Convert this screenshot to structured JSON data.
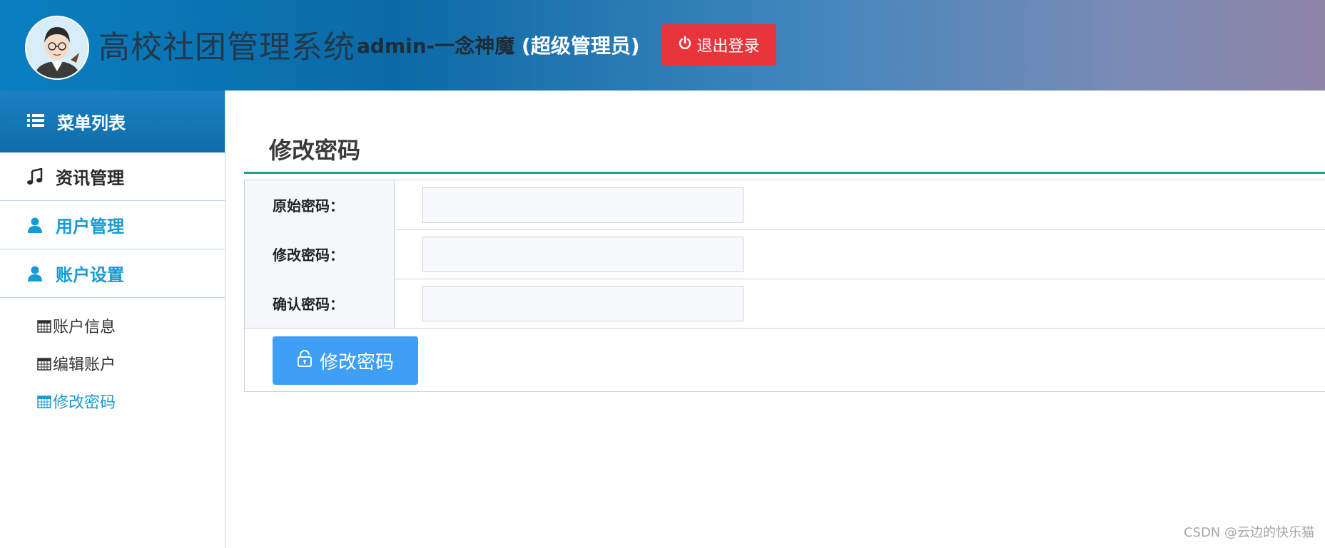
{
  "header": {
    "app_title": "高校社团管理系统",
    "user_name": "admin-一念神魔",
    "user_role": "(超级管理员)",
    "logout_label": "退出登录",
    "logout_icon": "power-icon",
    "logout_color": "#e8353b"
  },
  "sidebar": {
    "menu_title": "菜单列表",
    "menu_icon": "list-icon",
    "items": [
      {
        "label": "资讯管理",
        "icon": "music-note-icon"
      },
      {
        "label": "用户管理",
        "icon": "user-icon"
      },
      {
        "label": "账户设置",
        "icon": "user-icon"
      }
    ],
    "subitems": [
      {
        "label": "账户信息",
        "icon": "calendar-icon"
      },
      {
        "label": "编辑账户",
        "icon": "calendar-icon"
      },
      {
        "label": "修改密码",
        "icon": "calendar-icon",
        "active": true
      }
    ]
  },
  "main": {
    "page_title": "修改密码",
    "fields": [
      {
        "label": "原始密码：",
        "value": ""
      },
      {
        "label": "修改密码：",
        "value": ""
      },
      {
        "label": "确认密码：",
        "value": ""
      }
    ],
    "submit_label": "修改密码",
    "submit_icon": "lock-icon",
    "accent_color": "#1aa58c"
  },
  "watermark": "CSDN @云边的快乐猫"
}
